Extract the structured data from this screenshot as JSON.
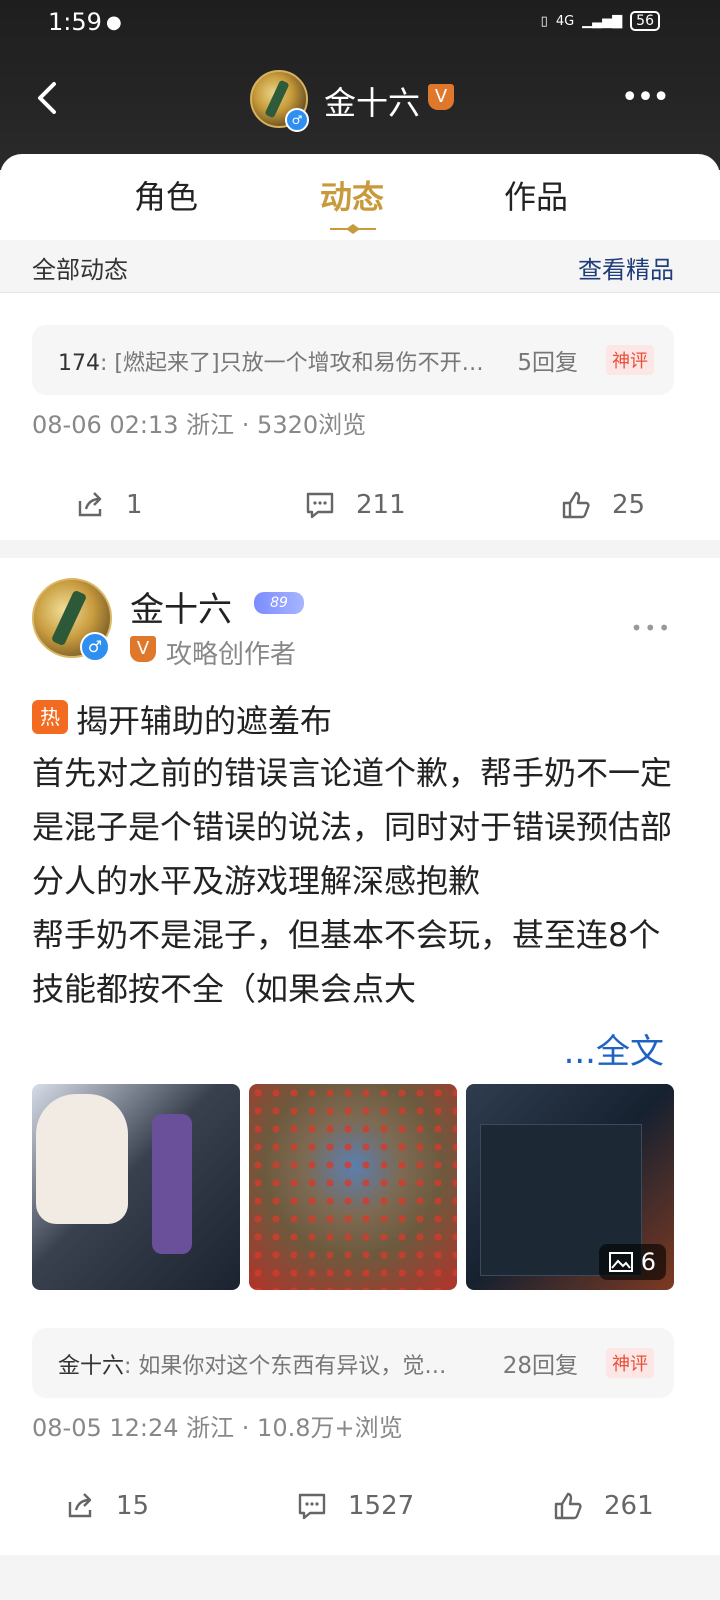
{
  "status_bar": {
    "time": "1:59",
    "network": "4G",
    "battery": "56"
  },
  "header": {
    "title": "金十六",
    "verified_badge": "V",
    "back_icon": "chevron-left-icon",
    "more_icon": "more-horizontal-icon"
  },
  "tabs": [
    {
      "label": "角色",
      "active": false
    },
    {
      "label": "动态",
      "active": true
    },
    {
      "label": "作品",
      "active": false
    }
  ],
  "subbar": {
    "left": "全部动态",
    "right": "查看精品"
  },
  "posts": [
    {
      "reply": {
        "author": "174",
        "text": ": [燃起来了]只放一个增攻和易伤不开…",
        "count": "5回复",
        "tag": "神评"
      },
      "meta": "08-06 02:13 浙江 · 5320浏览",
      "actions": {
        "share": "1",
        "comment": "211",
        "like": "25"
      }
    },
    {
      "author": {
        "name": "金十六",
        "level": "89",
        "role_badge": "V",
        "role": "攻略创作者"
      },
      "hot_tag": "热",
      "title": "揭开辅助的遮羞布",
      "body": "首先对之前的错误言论道个歉，帮手奶不一定是混子是个错误的说法，同时对于错误预估部分人的水平及游戏理解深感抱歉\n帮手奶不是混子，但基本不会玩，甚至连8个技能都按不全（如果会点大",
      "full_text": "...全文",
      "photo_count": "6",
      "reply": {
        "author": "金十六",
        "text": ": 如果你对这个东西有异议，觉…",
        "count": "28回复",
        "tag": "神评"
      },
      "meta": "08-05 12:24 浙江 · 10.8万+浏览",
      "actions": {
        "share": "15",
        "comment": "1527",
        "like": "261"
      }
    }
  ],
  "colors": {
    "accent_gold": "#c89a3c",
    "link_blue": "#1e63c4",
    "hot_red": "#e8503a",
    "hot_orange": "#f36b21"
  }
}
